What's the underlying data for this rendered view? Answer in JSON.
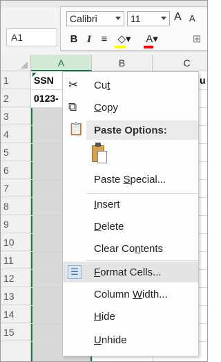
{
  "name_box": {
    "value": "A1"
  },
  "mini_toolbar": {
    "font_name": "Calibri",
    "font_size": "11",
    "grow_font": "A",
    "shrink_font": "A",
    "bold": "B",
    "italic": "I",
    "align": "≡",
    "fill_glyph": "◇▾",
    "font_color_glyph": "A▾",
    "border_glyph": "⊞",
    "fill_color": "#FFFF00",
    "font_color": "#FF0000"
  },
  "columns": [
    "A",
    "B",
    "C"
  ],
  "rows": [
    "1",
    "2",
    "3",
    "4",
    "5",
    "6",
    "7",
    "8",
    "9",
    "10",
    "11",
    "12",
    "13",
    "14",
    "15"
  ],
  "cells": {
    "A1": "SSN",
    "A2": "0123-",
    "C1_partial": "u"
  },
  "context_menu": {
    "cut": {
      "label_pre": "Cu",
      "label_u": "t",
      "label_post": ""
    },
    "copy": {
      "label_pre": "",
      "label_u": "C",
      "label_post": "opy"
    },
    "paste_options": "Paste Options:",
    "paste_special": {
      "label_pre": "Paste ",
      "label_u": "S",
      "label_post": "pecial..."
    },
    "insert": {
      "label_pre": "",
      "label_u": "I",
      "label_post": "nsert"
    },
    "delete": {
      "label_pre": "",
      "label_u": "D",
      "label_post": "elete"
    },
    "clear_contents": {
      "label_pre": "Clear Co",
      "label_u": "n",
      "label_post": "tents"
    },
    "format_cells": {
      "label_pre": "",
      "label_u": "F",
      "label_post": "ormat Cells..."
    },
    "column_width": {
      "label_pre": "Column ",
      "label_u": "W",
      "label_post": "idth..."
    },
    "hide": {
      "label_pre": "",
      "label_u": "H",
      "label_post": "ide"
    },
    "unhide": {
      "label_pre": "",
      "label_u": "U",
      "label_post": "nhide"
    }
  },
  "colors": {
    "excel_green": "#217346",
    "selected_column": "#D9D9D9",
    "menu_highlight": "#E4E4E4"
  }
}
